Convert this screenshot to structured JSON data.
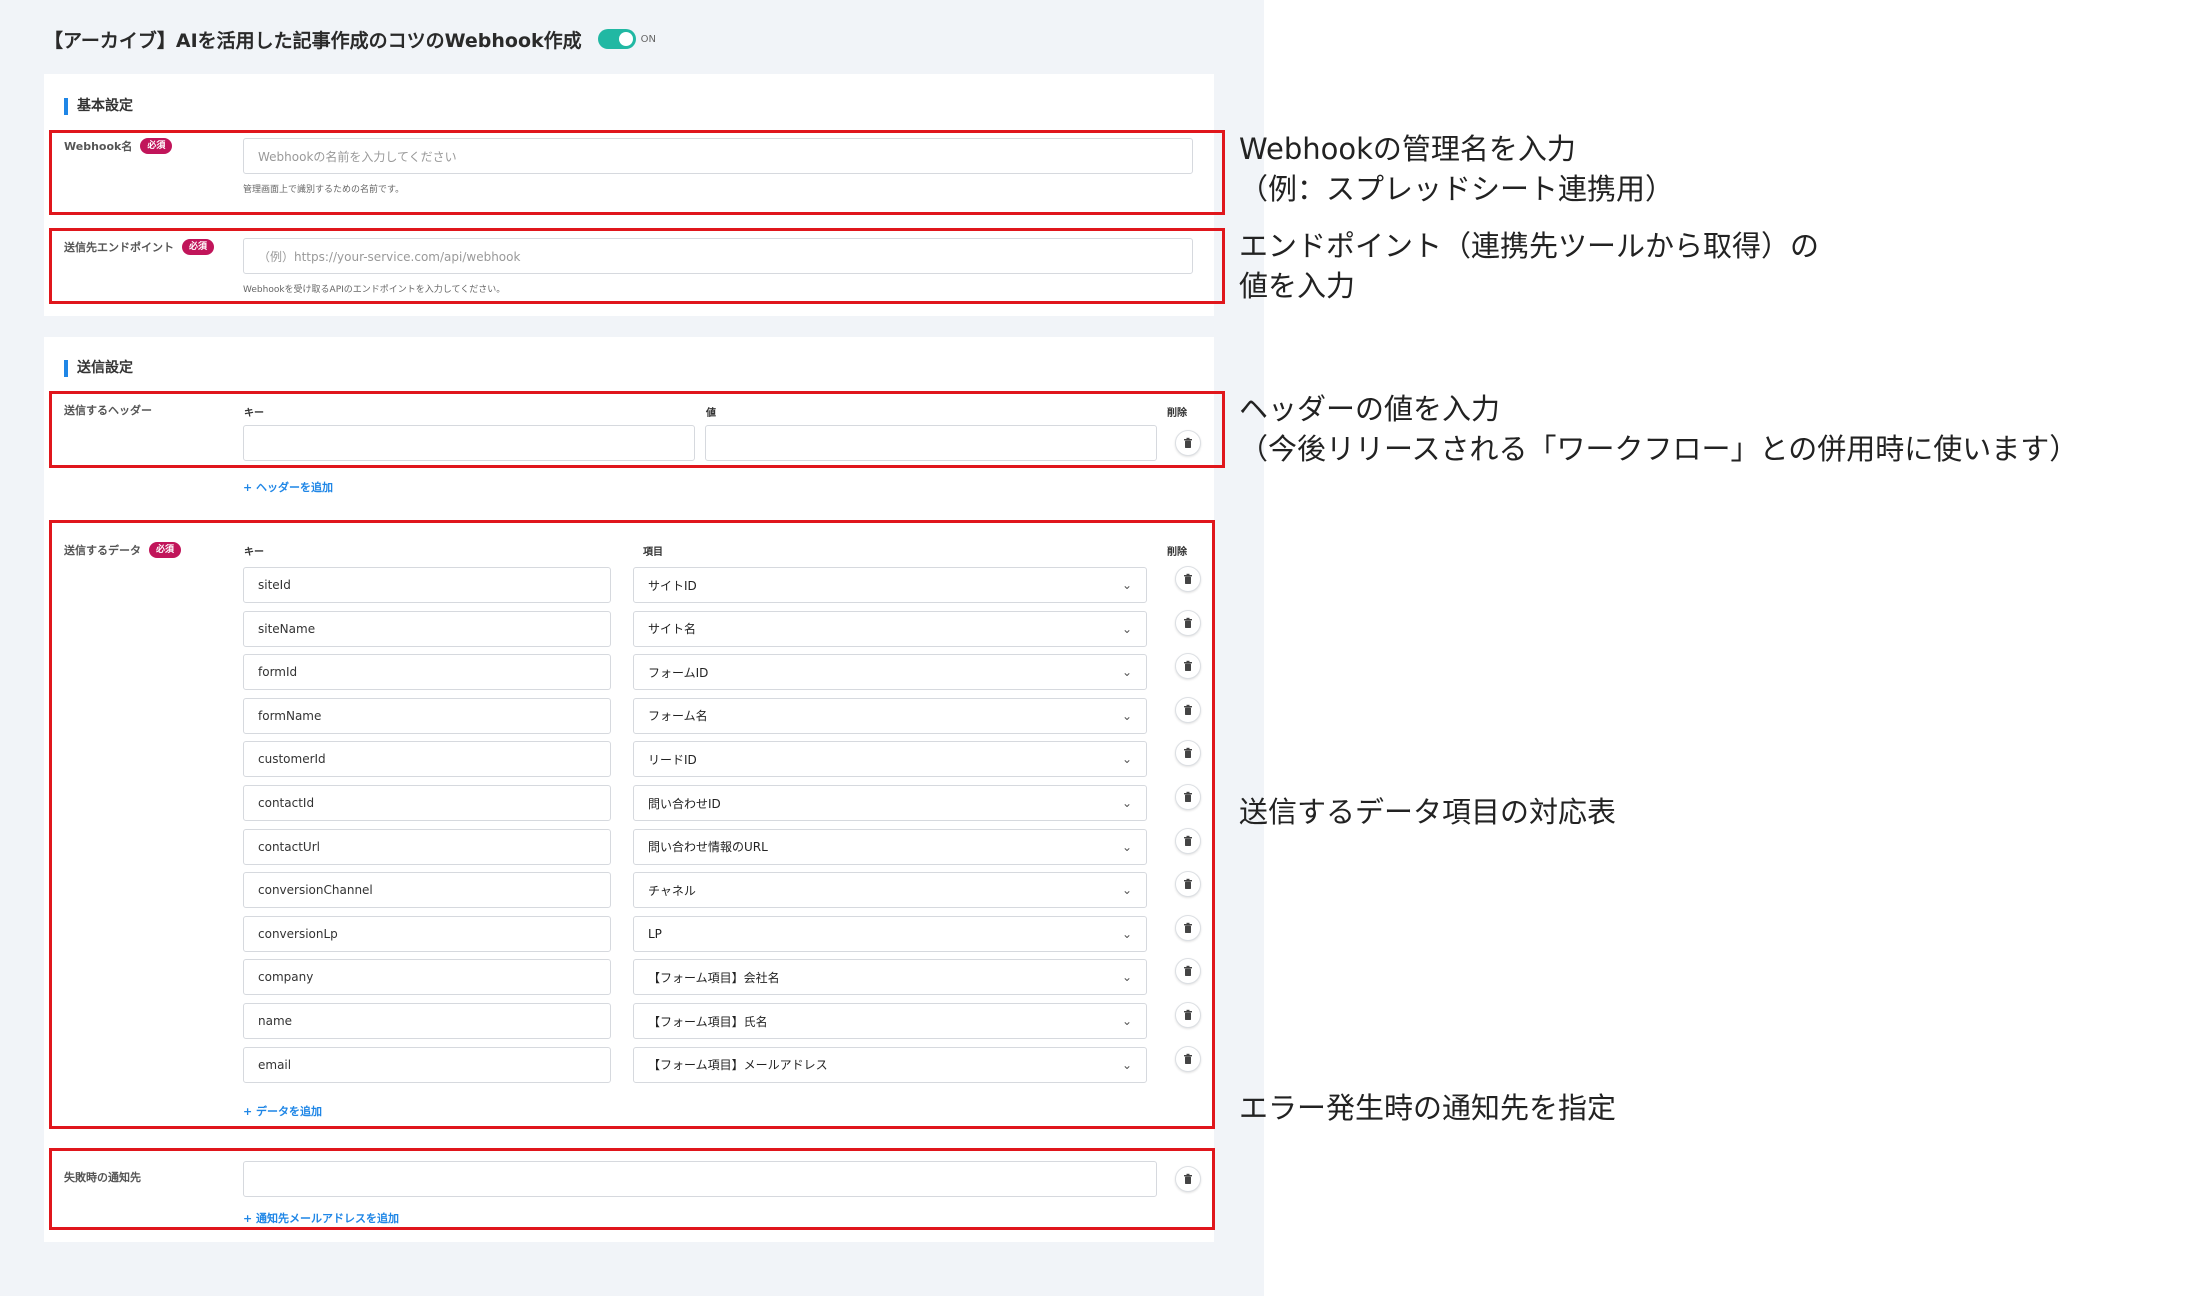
{
  "header": {
    "title": "【アーカイブ】AIを活用した記事作成のコツのWebhook作成",
    "toggle_label": "ON"
  },
  "basic": {
    "section_title": "基本設定",
    "name_label": "Webhook名",
    "required": "必須",
    "name_placeholder": "Webhookの名前を入力してください",
    "name_hint": "管理画面上で識別するための名前です。",
    "endpoint_label": "送信先エンドポイント",
    "endpoint_placeholder": "（例）https://your-service.com/api/webhook",
    "endpoint_hint": "Webhookを受け取るAPIのエンドポイントを入力してください。"
  },
  "send": {
    "section_title": "送信設定",
    "headers_label": "送信するヘッダー",
    "headers_key": "キー",
    "headers_value": "値",
    "headers_delete": "削除",
    "add_header": "+ ヘッダーを追加",
    "data_label": "送信するデータ",
    "data_key": "キー",
    "data_item": "項目",
    "data_delete": "削除",
    "rows": [
      {
        "key": "siteId",
        "item": "サイトID"
      },
      {
        "key": "siteName",
        "item": "サイト名"
      },
      {
        "key": "formId",
        "item": "フォームID"
      },
      {
        "key": "formName",
        "item": "フォーム名"
      },
      {
        "key": "customerId",
        "item": "リードID"
      },
      {
        "key": "contactId",
        "item": "問い合わせID"
      },
      {
        "key": "contactUrl",
        "item": "問い合わせ情報のURL"
      },
      {
        "key": "conversionChannel",
        "item": "チャネル"
      },
      {
        "key": "conversionLp",
        "item": "LP"
      },
      {
        "key": "company",
        "item": "【フォーム項目】会社名"
      },
      {
        "key": "name",
        "item": "【フォーム項目】氏名"
      },
      {
        "key": "email",
        "item": "【フォーム項目】メールアドレス"
      }
    ],
    "add_data": "+ データを追加",
    "failure_label": "失敗時の通知先",
    "add_email": "+ 通知先メールアドレスを追加"
  },
  "annotations": {
    "a1_line1": "Webhookの管理名を入力",
    "a1_line2": "（例：スプレッドシート連携用）",
    "a2_line1": "エンドポイント（連携先ツールから取得）の",
    "a2_line2": "値を入力",
    "a3_line1": "ヘッダーの値を入力",
    "a3_line2": "（今後リリースされる「ワークフロー」との併用時に使います）",
    "a4": "送信するデータ項目の対応表",
    "a5": "エラー発生時の通知先を指定"
  },
  "colors": {
    "accent": "#1f86e6",
    "toggle": "#21b8a3",
    "required_badge": "#c1155a",
    "highlight": "#e0161c"
  }
}
